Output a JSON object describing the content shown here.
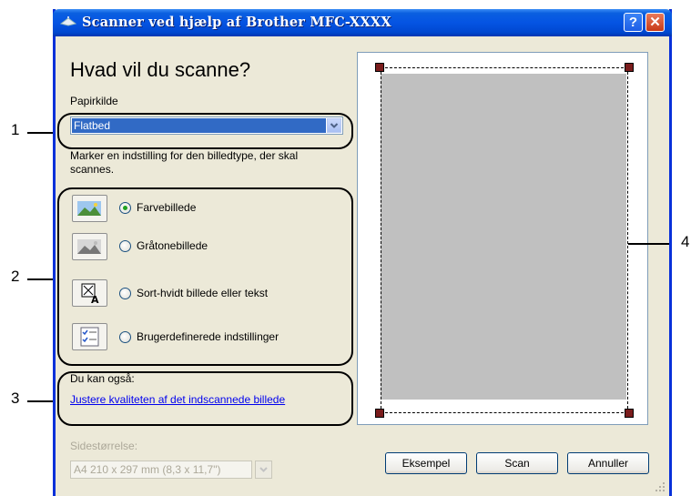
{
  "window": {
    "title": "Scanner ved hjælp af Brother  MFC-XXXX",
    "help_button": "?",
    "close_button": "✕"
  },
  "main": {
    "heading": "Hvad vil du scanne?",
    "paper_source_label": "Papirkilde",
    "paper_source_value": "Flatbed",
    "image_type_hint": "Marker en indstilling for den billedtype, der skal scannes.",
    "options": [
      {
        "label": "Farvebillede",
        "icon": "color-photo-icon",
        "selected": true
      },
      {
        "label": "Gråtonebillede",
        "icon": "grayscale-photo-icon",
        "selected": false
      },
      {
        "label": "Sort-hvidt billede eller tekst",
        "icon": "black-white-text-icon",
        "selected": false
      },
      {
        "label": "Brugerdefinerede indstillinger",
        "icon": "custom-settings-icon",
        "selected": false
      }
    ],
    "also_label": "Du kan også:",
    "adjust_link": "Justere kvaliteten af det indscannede billede",
    "page_size_label": "Sidestørrelse:",
    "page_size_value": "A4 210 x 297 mm (8,3 x 11,7\")"
  },
  "buttons": {
    "preview": "Eksempel",
    "scan": "Scan",
    "cancel": "Annuller"
  },
  "callouts": [
    "1",
    "2",
    "3",
    "4"
  ],
  "colors": {
    "title_bar": "#0554e3",
    "selection": "#316ac5",
    "preview_area": "#c0c0c0",
    "handle": "#7a1c1c",
    "link": "#0000ee"
  }
}
